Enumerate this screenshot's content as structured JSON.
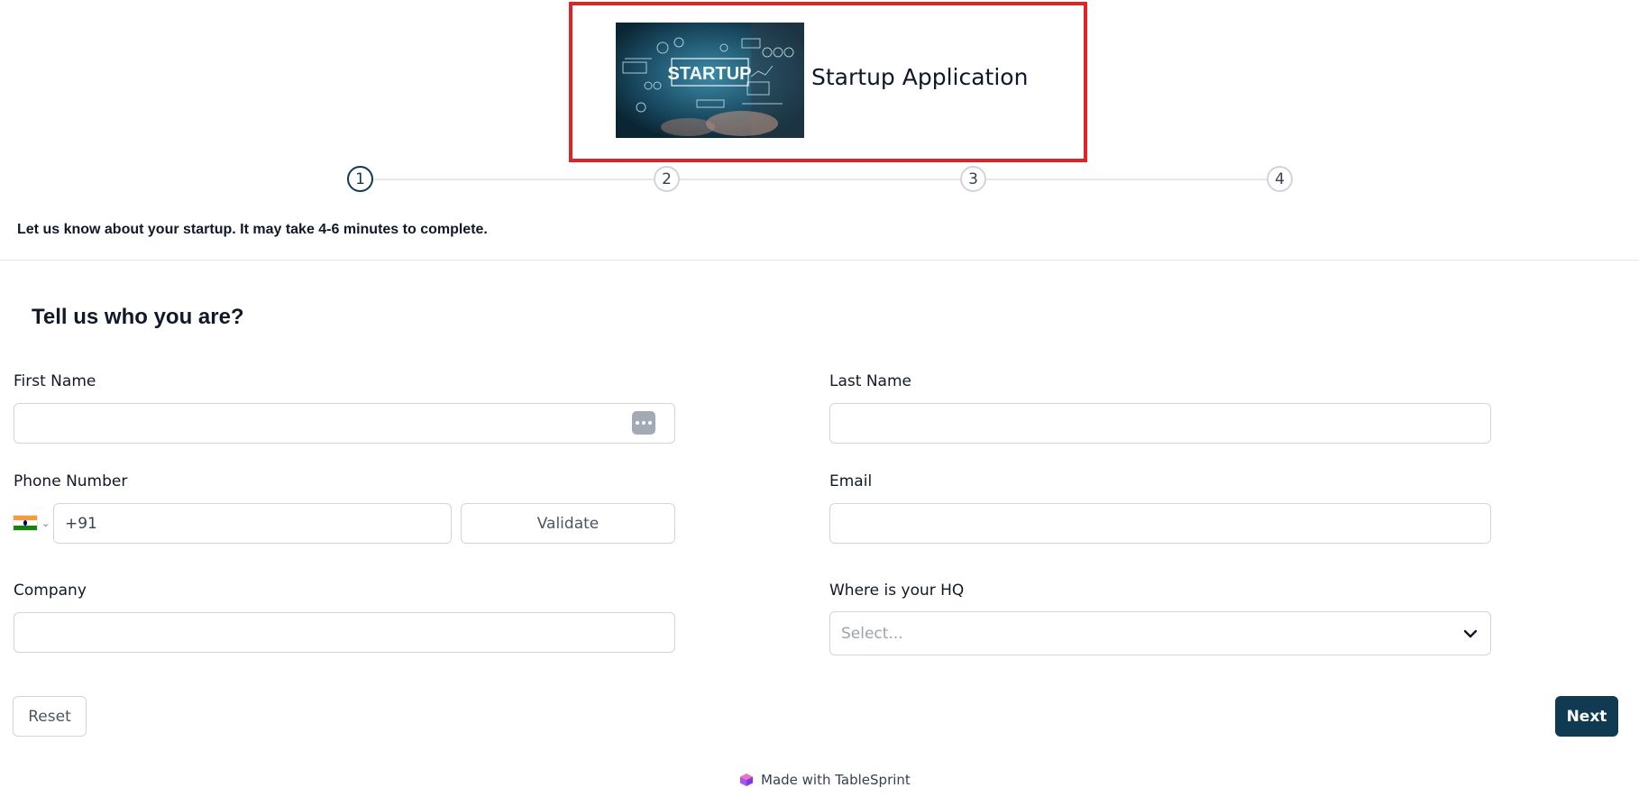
{
  "header": {
    "image_name": "startup-banner-image",
    "image_text": "STARTUP",
    "title": "Startup Application"
  },
  "stepper": {
    "steps": [
      "1",
      "2",
      "3",
      "4"
    ],
    "active_step": 1,
    "active_color": "#0f3a52"
  },
  "intro_text": "Let us know about your startup. It may take 4-6 minutes to complete.",
  "form": {
    "section_title": "Tell us who you are?",
    "first_name": {
      "label": "First Name",
      "value": ""
    },
    "last_name": {
      "label": "Last Name",
      "value": ""
    },
    "phone": {
      "label": "Phone Number",
      "country_code": "+91",
      "country_icon": "india-flag-icon",
      "validate_label": "Validate"
    },
    "email": {
      "label": "Email",
      "value": ""
    },
    "company": {
      "label": "Company",
      "value": ""
    },
    "hq": {
      "label": "Where is your HQ",
      "placeholder": "Select..."
    }
  },
  "actions": {
    "reset_label": "Reset",
    "next_label": "Next",
    "primary_color": "#0f3a52"
  },
  "footer": {
    "text": "Made with TableSprint",
    "logo_icon": "tablesprint-logo-icon"
  }
}
